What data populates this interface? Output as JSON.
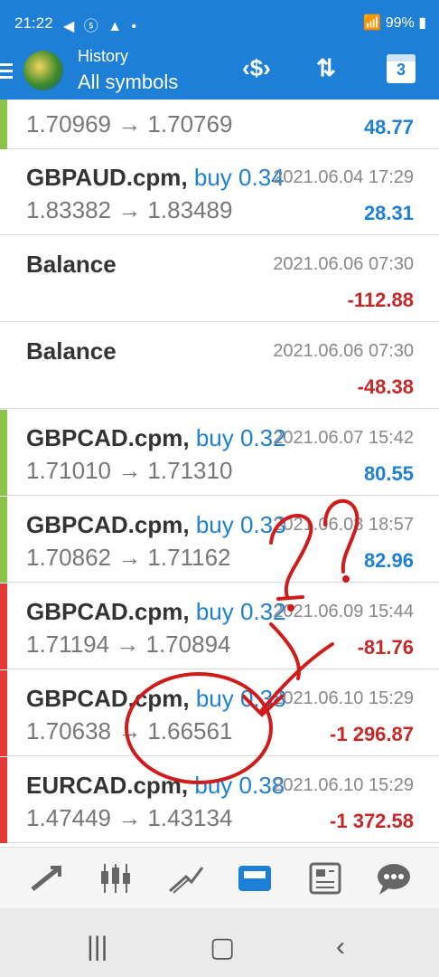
{
  "status_bar": {
    "time": "21:22",
    "notif_icons": "◀ ⓢ ▲ •",
    "battery": "99%"
  },
  "app_bar": {
    "title": "History",
    "subtitle": "All symbols",
    "calendar_day": "3"
  },
  "rows": [
    {
      "symbol": "",
      "type": "",
      "datetime": "",
      "prices": "1.70969 → 1.70769",
      "profit": "48.77",
      "bar": "#8bc34a",
      "sign": "pos"
    },
    {
      "symbol": "GBPAUD.cpm,",
      "type": "buy 0.34",
      "datetime": "2021.06.04 17:29",
      "prices": "1.83382 → 1.83489",
      "profit": "28.31",
      "bar": "",
      "sign": "pos"
    },
    {
      "symbol": "Balance",
      "type": "",
      "datetime": "2021.06.06 07:30",
      "prices": "",
      "profit": "-112.88",
      "bar": "",
      "sign": "neg"
    },
    {
      "symbol": "Balance",
      "type": "",
      "datetime": "2021.06.06 07:30",
      "prices": "",
      "profit": "-48.38",
      "bar": "",
      "sign": "neg"
    },
    {
      "symbol": "GBPCAD.cpm,",
      "type": "buy 0.32",
      "datetime": "2021.06.07 15:42",
      "prices": "1.71010 → 1.71310",
      "profit": "80.55",
      "bar": "#8bc34a",
      "sign": "pos"
    },
    {
      "symbol": "GBPCAD.cpm,",
      "type": "buy 0.33",
      "datetime": "2021.06.08 18:57",
      "prices": "1.70862 → 1.71162",
      "profit": "82.96",
      "bar": "#8bc34a",
      "sign": "pos"
    },
    {
      "symbol": "GBPCAD.cpm,",
      "type": "buy 0.32",
      "datetime": "2021.06.09 15:44",
      "prices": "1.71194 → 1.70894",
      "profit": "-81.76",
      "bar": "#e53935",
      "sign": "neg"
    },
    {
      "symbol": "GBPCAD.cpm,",
      "type": "buy 0.38",
      "datetime": "2021.06.10 15:29",
      "prices": "1.70638 → 1.66561",
      "profit": "-1 296.87",
      "bar": "#e53935",
      "sign": "neg"
    },
    {
      "symbol": "EURCAD.cpm,",
      "type": "buy 0.38",
      "datetime": "2021.06.10 15:29",
      "prices": "1.47449 → 1.43134",
      "profit": "-1 372.58",
      "bar": "#e53935",
      "sign": "neg"
    }
  ],
  "bottom_nav": [
    "quotes-icon",
    "chart-icon",
    "trade-icon",
    "history-icon",
    "news-icon",
    "chat-icon"
  ],
  "annotation": {
    "text": "??",
    "color": "#d11a1a"
  }
}
